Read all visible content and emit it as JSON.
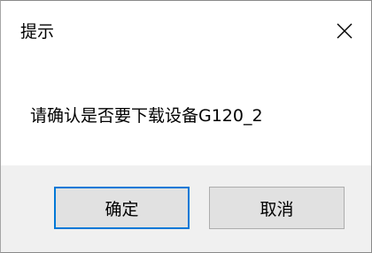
{
  "dialog": {
    "title": "提示",
    "close_icon": "close-icon",
    "message": "请确认是否要下载设备G120_2",
    "buttons": {
      "ok_label": "确定",
      "cancel_label": "取消"
    }
  },
  "colors": {
    "focus_border": "#0078d7",
    "footer_bg": "#f0f0f0",
    "button_bg": "#e1e1e1"
  }
}
